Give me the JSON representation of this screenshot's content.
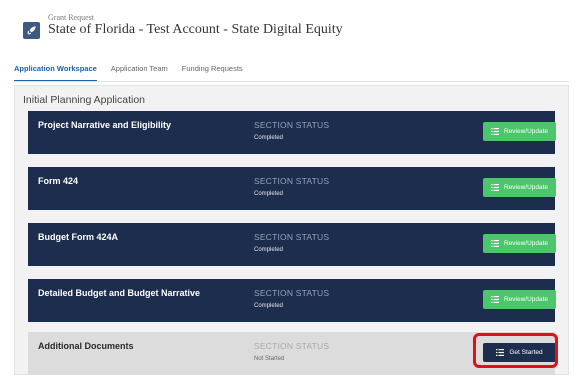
{
  "header": {
    "eyebrow": "Grant Request",
    "title": "State of Florida - Test Account - State Digital Equity",
    "icon": "rocket-icon"
  },
  "tabs": [
    {
      "label": "Application Workspace",
      "active": true
    },
    {
      "label": "Application Team",
      "active": false
    },
    {
      "label": "Funding Requests",
      "active": false
    }
  ],
  "panel": {
    "title": "Initial Planning Application",
    "sections": [
      {
        "name": "Project Narrative and Eligibility",
        "status_label": "SECTION STATUS",
        "status": "Completed",
        "button": "Review/Update"
      },
      {
        "name": "Form 424",
        "status_label": "SECTION STATUS",
        "status": "Completed",
        "button": "Review/Update"
      },
      {
        "name": "Budget Form 424A",
        "status_label": "SECTION STATUS",
        "status": "Completed",
        "button": "Review/Update"
      },
      {
        "name": "Detailed Budget and Budget Narrative",
        "status_label": "SECTION STATUS",
        "status": "Completed",
        "button": "Review/Update"
      },
      {
        "name": "Additional Documents",
        "status_label": "SECTION STATUS",
        "status": "Not Started",
        "button": "Get Started"
      }
    ]
  },
  "colors": {
    "row_bg": "#1c2d4d",
    "pending_row_bg": "#dcdcdc",
    "review_button": "#4cc66a",
    "start_button": "#1c2d4d",
    "highlight": "#e0101a",
    "active_tab": "#1f5ea8"
  }
}
